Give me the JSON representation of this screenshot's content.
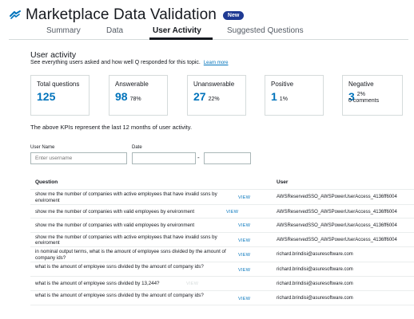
{
  "header": {
    "title": "Marketplace Data Validation",
    "badge": "New"
  },
  "tabs": [
    {
      "label": "Summary"
    },
    {
      "label": "Data"
    },
    {
      "label": "User Activity"
    },
    {
      "label": "Suggested Questions"
    }
  ],
  "activity": {
    "title": "User activity",
    "description": "See everything users asked and how well Q responded for this topic.",
    "learn_more": "Learn more",
    "kpi_note": "The above KPIs represent the last 12 months of user activity."
  },
  "kpis": [
    {
      "label": "Total questions",
      "value": "125"
    },
    {
      "label": "Answerable",
      "value": "98",
      "pct": "78%"
    },
    {
      "label": "Unanswerable",
      "value": "27",
      "pct": "22%"
    },
    {
      "label": "Positive",
      "value": "1",
      "pct": "1%"
    },
    {
      "label": "Negative",
      "value": "3",
      "pct": "2%",
      "sub": "0 comments"
    }
  ],
  "filters": {
    "user_name_label": "User Name",
    "user_name_placeholder": "Enter username",
    "date_label": "Date",
    "date_separator": "-"
  },
  "table": {
    "headers": {
      "question": "Question",
      "user": "User"
    },
    "view_label": "VIEW",
    "rows": [
      {
        "question": "show me the number of companies with active employees that have invalid ssns by enviroment",
        "user": "AWSReservedSSO_AWSPowerUserAccess_4136ff6004"
      },
      {
        "question": "show me the number of companies with valid employees by environment",
        "user": "AWSReservedSSO_AWSPowerUserAccess_4136ff6004"
      },
      {
        "question": "show me the number of companies with valid employees by environment",
        "user": "AWSReservedSSO_AWSPowerUserAccess_4136ff6004"
      },
      {
        "question": "show me the number of companies with active employees that have invalid ssns by enviroment",
        "user": "AWSReservedSSO_AWSPowerUserAccess_4136ff6004"
      },
      {
        "question": "in nominal output terms, what is the amount of employee ssns divided by the amount of company ids?",
        "user": "richard.brindisi@asuresoftware.com"
      },
      {
        "question": "what is the amount of employee ssns divided by the amount of company ids?",
        "user": "richard.brindisi@asuresoftware.com"
      },
      {
        "question": "what is the amount of employee ssns divided by 13,244?",
        "user": "richard.brindisi@asuresoftware.com"
      },
      {
        "question": "what is the amount of employee ssns divided by the amount of company ids?",
        "user": "richard.brindisi@asuresoftware.com"
      }
    ]
  },
  "colors": {
    "accent": "#0073bb",
    "badge": "#1f3a93",
    "border": "#d5dbdb"
  }
}
